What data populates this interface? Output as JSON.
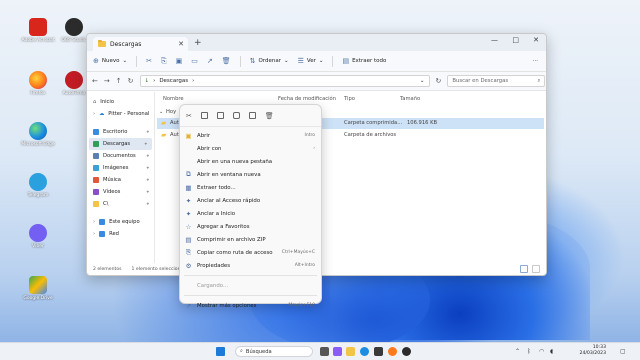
{
  "desktop": {
    "icons": [
      {
        "label": "Adobe Acrobat",
        "color": "#d9261c",
        "glyph": "A"
      },
      {
        "label": "OBS Studio",
        "color": "#2b2b2b",
        "glyph": "●"
      },
      {
        "label": "Firefox",
        "color": "#ff7a1a",
        "glyph": "◉"
      },
      {
        "label": "AutoFirma",
        "color": "#c21d24",
        "glyph": "≡"
      },
      {
        "label": "Microsoft Edge",
        "color": "#1c8de0",
        "glyph": "e"
      },
      {
        "label": "Telegram",
        "color": "#2ba0df",
        "glyph": "➤"
      },
      {
        "label": "Viber",
        "color": "#7360f2",
        "glyph": "☏"
      },
      {
        "label": "Google Drive",
        "color": "#2f9e44",
        "glyph": "▲"
      }
    ]
  },
  "explorer": {
    "tab_title": "Descargas",
    "window_controls": {
      "minimize": "—",
      "maximize": "□",
      "close": "✕"
    },
    "toolbar": {
      "new_label": "Nuevo",
      "sort_label": "Ordenar",
      "view_label": "Ver",
      "extract_label": "Extraer todo"
    },
    "address": {
      "path": "Descargas",
      "separator": "›"
    },
    "search_placeholder": "Buscar en Descargas",
    "nav": {
      "inicio": "Inicio",
      "onedrive": "Pitter - Personal",
      "escritorio": "Escritorio",
      "descargas": "Descargas",
      "documentos": "Documentos",
      "imagenes": "Imágenes",
      "musica": "Música",
      "videos": "Vídeos",
      "c": "C\\",
      "equipo": "Este equipo",
      "red": "Red"
    },
    "columns": {
      "name": "Nombre",
      "date": "Fecha de modificación",
      "type": "Tipo",
      "size": "Tamaño"
    },
    "group_label": "Hoy",
    "rows": [
      {
        "name": "AutoF",
        "type": "Carpeta comprimida...",
        "size": "106.916 KB",
        "selected": true
      },
      {
        "name": "AutoFi",
        "type": "Carpeta de archivos",
        "size": "",
        "selected": false
      }
    ],
    "status": {
      "count": "2 elementos",
      "selected": "1 elemento seleccionado"
    }
  },
  "context_menu": {
    "items": [
      {
        "label": "Abrir",
        "shortcut": "Intro",
        "icon": "▣"
      },
      {
        "label": "Abrir con",
        "shortcut": "›",
        "icon": "◻"
      },
      {
        "label": "Abrir en una nueva pestaña",
        "shortcut": "",
        "icon": "◫"
      },
      {
        "label": "Abrir en ventana nueva",
        "shortcut": "",
        "icon": "⧉"
      },
      {
        "label": "Extraer todo...",
        "shortcut": "",
        "icon": "▦"
      },
      {
        "label": "Anclar al Acceso rápido",
        "shortcut": "",
        "icon": "✦"
      },
      {
        "label": "Anclar a Inicio",
        "shortcut": "",
        "icon": "✦"
      },
      {
        "label": "Agregar a Favoritos",
        "shortcut": "",
        "icon": "☆"
      },
      {
        "label": "Comprimir en archivo ZIP",
        "shortcut": "",
        "icon": "▤"
      },
      {
        "label": "Copiar como ruta de acceso",
        "shortcut": "Ctrl+Mayús+C",
        "icon": "⎘"
      },
      {
        "label": "Propiedades",
        "shortcut": "Alt+Intro",
        "icon": "⚙"
      }
    ],
    "loading": "Cargando...",
    "more_options": {
      "label": "Mostrar más opciones",
      "shortcut": "Mayús+F10"
    }
  },
  "taskbar": {
    "search_label": "Búsqueda",
    "time": "10:33",
    "date": "24/03/2023"
  }
}
